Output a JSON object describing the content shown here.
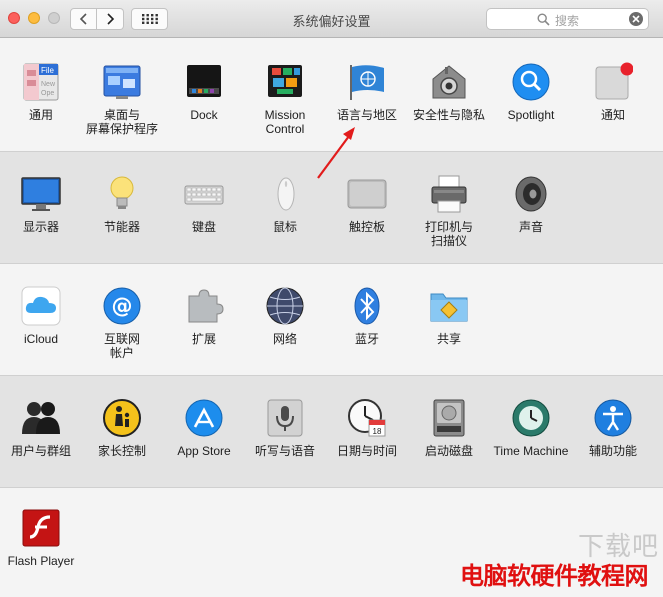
{
  "window": {
    "title": "系统偏好设置"
  },
  "search": {
    "placeholder": "搜索"
  },
  "rows": [
    {
      "items": [
        {
          "label": "通用",
          "icon": "general-icon"
        },
        {
          "label": "桌面与\n屏幕保护程序",
          "icon": "desktop-screensaver-icon"
        },
        {
          "label": "Dock",
          "icon": "dock-icon"
        },
        {
          "label": "Mission\nControl",
          "icon": "mission-control-icon"
        },
        {
          "label": "语言与地区",
          "icon": "language-region-icon"
        },
        {
          "label": "安全性与隐私",
          "icon": "security-privacy-icon"
        },
        {
          "label": "Spotlight",
          "icon": "spotlight-icon"
        },
        {
          "label": "通知",
          "icon": "notifications-icon"
        }
      ]
    },
    {
      "items": [
        {
          "label": "显示器",
          "icon": "displays-icon"
        },
        {
          "label": "节能器",
          "icon": "energy-saver-icon"
        },
        {
          "label": "键盘",
          "icon": "keyboard-icon"
        },
        {
          "label": "鼠标",
          "icon": "mouse-icon"
        },
        {
          "label": "触控板",
          "icon": "trackpad-icon"
        },
        {
          "label": "打印机与\n扫描仪",
          "icon": "printer-scanner-icon"
        },
        {
          "label": "声音",
          "icon": "sound-icon"
        }
      ]
    },
    {
      "items": [
        {
          "label": "iCloud",
          "icon": "icloud-icon"
        },
        {
          "label": "互联网\n帐户",
          "icon": "internet-accounts-icon"
        },
        {
          "label": "扩展",
          "icon": "extensions-icon"
        },
        {
          "label": "网络",
          "icon": "network-icon"
        },
        {
          "label": "蓝牙",
          "icon": "bluetooth-icon"
        },
        {
          "label": "共享",
          "icon": "sharing-icon"
        }
      ]
    },
    {
      "items": [
        {
          "label": "用户与群组",
          "icon": "users-groups-icon"
        },
        {
          "label": "家长控制",
          "icon": "parental-controls-icon"
        },
        {
          "label": "App Store",
          "icon": "app-store-icon"
        },
        {
          "label": "听写与语音",
          "icon": "dictation-speech-icon"
        },
        {
          "label": "日期与时间",
          "icon": "date-time-icon"
        },
        {
          "label": "启动磁盘",
          "icon": "startup-disk-icon"
        },
        {
          "label": "Time Machine",
          "icon": "time-machine-icon"
        },
        {
          "label": "辅助功能",
          "icon": "accessibility-icon"
        }
      ]
    },
    {
      "items": [
        {
          "label": "Flash Player",
          "icon": "flash-player-icon"
        }
      ]
    }
  ],
  "calendar_day": "18",
  "watermark": {
    "main": "电脑软硬件教程网",
    "faint": "下载吧"
  }
}
